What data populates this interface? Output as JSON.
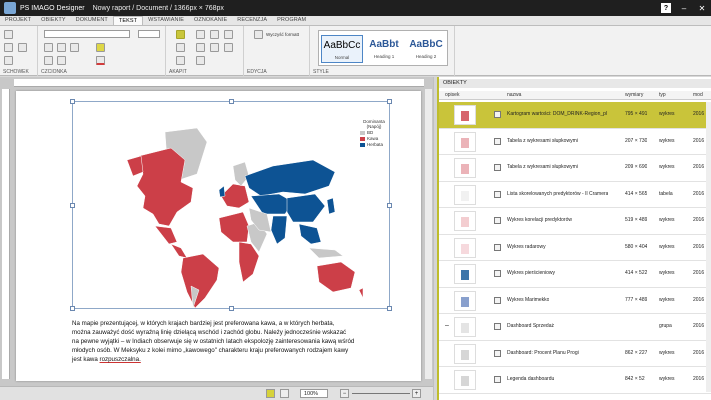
{
  "titlebar": {
    "app": "PS IMAGO Designer",
    "doc": "Nowy raport / Document / 1366px × 768px",
    "help": "?"
  },
  "menu": [
    "PROJEKT",
    "OBIEKTY",
    "DOKUMENT",
    "TEKST",
    "WSTAWIANIE",
    "OZNOKANIE",
    "RECENZJA",
    "PROGRAM"
  ],
  "ribbon": {
    "groups": [
      "SCHOWEK",
      "CZCIONKA",
      "AKAPIT",
      "EDYCJA",
      "STYLE"
    ],
    "edit_btn": "Wyczyść formatt",
    "styles": [
      {
        "sample": "AaBbCc",
        "name": "Normal"
      },
      {
        "sample": "AaBbt",
        "name": "Heading 1"
      },
      {
        "sample": "AaBbC",
        "name": "Heading 2"
      }
    ]
  },
  "chart": {
    "legend_title": "Dominanta\n(Napój)",
    "legend": [
      {
        "label": "BD",
        "color": "#c8c8c8"
      },
      {
        "label": "Kawa",
        "color": "#cc3f48"
      },
      {
        "label": "Herbata",
        "color": "#0d5394"
      }
    ]
  },
  "paragraph": {
    "lines": [
      "Na mapie prezentującej, w których krajach bardziej jest preferowana kawa, a w których herbata,",
      "można zauważyć dość wyraźną linię dzielącą wschód i zachód globu. Należy jednocześnie wskazać",
      "na pewne wyjątki – w Indiach obserwuje się w ostatnich latach ekspolozję zainteresowania kawą wśród",
      "młodych osób. W Meksyku z kolei mimo „kawowego\" charakteru kraju preferowanych rodzajem kawy"
    ],
    "last_prefix": "jest kawa ",
    "last_underlined": "rozpuszczalna."
  },
  "status": {
    "zoom": "100%"
  },
  "panel": {
    "title": "OBIEKTY",
    "headers": [
      "opisek",
      "nazwa",
      "wymiary",
      "typ",
      "mod"
    ],
    "rows": [
      {
        "name": "Kartogram wartości: DOM_DRINK-Region_pl",
        "dims": "795 × 491",
        "type": "wykres",
        "mod": "2016",
        "sel": true
      },
      {
        "name": "Tabela z wykresami słupkowymi",
        "dims": "207 × 730",
        "type": "wykres",
        "mod": "2016"
      },
      {
        "name": "Tabela z wykresami słupkowymi",
        "dims": "209 × 690",
        "type": "wykres",
        "mod": "2016"
      },
      {
        "name": "Lista skorelowanych predyktorów - Il Cramera",
        "dims": "414 × 565",
        "type": "tabela",
        "mod": "2016"
      },
      {
        "name": "Wykres korelacji predyktorów",
        "dims": "519 × 489",
        "type": "wykres",
        "mod": "2016"
      },
      {
        "name": "Wykres radarowy",
        "dims": "580 × 404",
        "type": "wykres",
        "mod": "2016"
      },
      {
        "name": "Wykres pierścieniowy",
        "dims": "414 × 522",
        "type": "wykres",
        "mod": "2016"
      },
      {
        "name": "Wykres Marimekko",
        "dims": "777 × 489",
        "type": "wykres",
        "mod": "2016"
      },
      {
        "name": "Dashboard Sprzedaż",
        "dims": "",
        "type": "grupa",
        "mod": "2016",
        "group": true,
        "expander": "–"
      },
      {
        "name": "Dashboard: Procent Planu Progi",
        "dims": "862 × 227",
        "type": "wykres",
        "mod": "2016"
      },
      {
        "name": "Legenda dashboardu",
        "dims": "842 × 52",
        "type": "wykres",
        "mod": "2016"
      }
    ]
  }
}
